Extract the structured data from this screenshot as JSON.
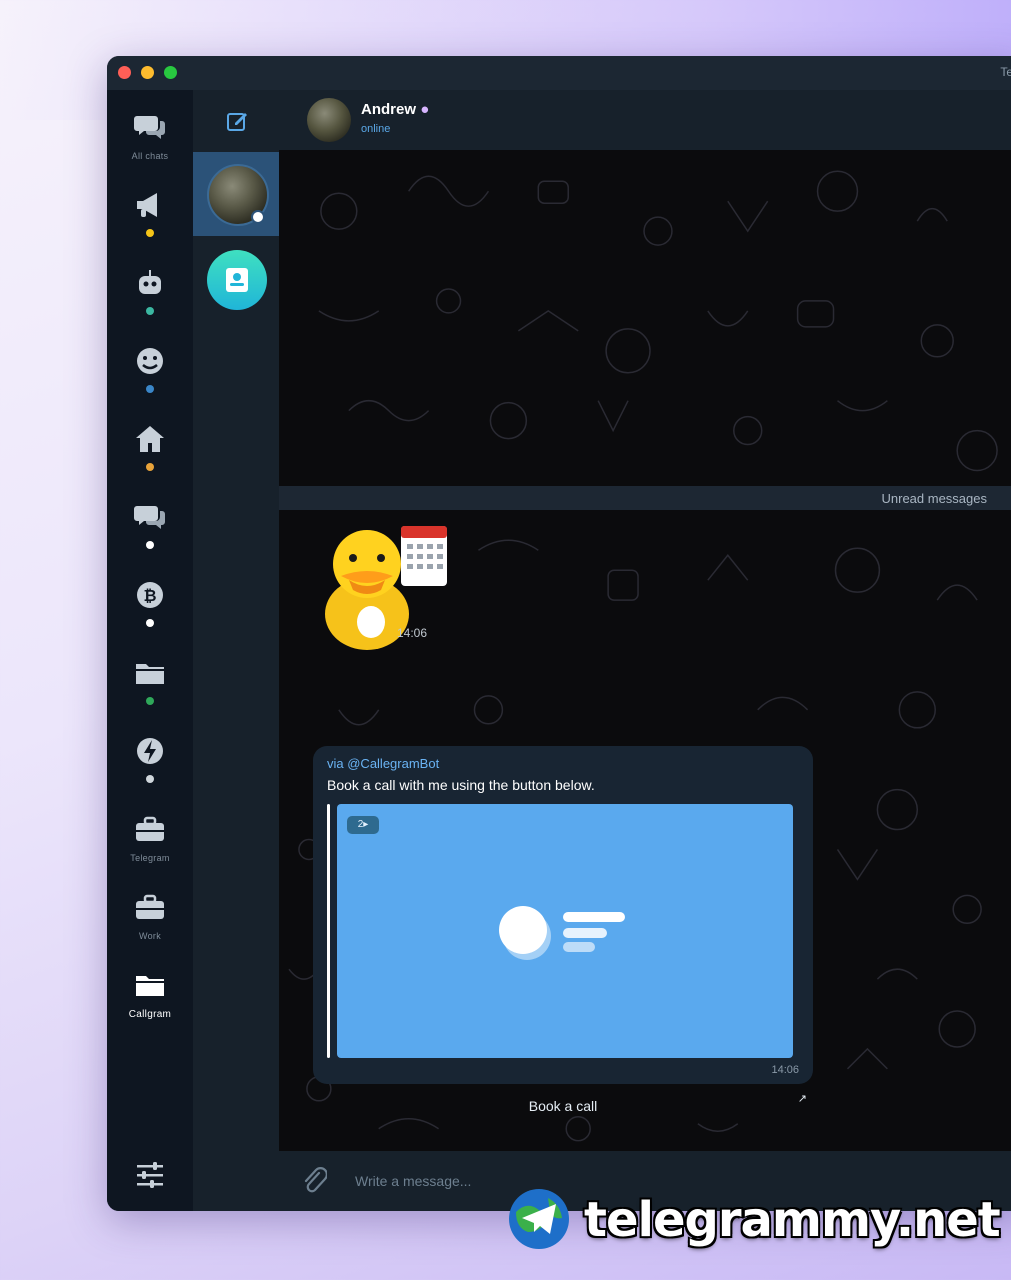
{
  "window": {
    "title": "Te"
  },
  "folders": [
    {
      "id": "all-chats",
      "label": "All chats",
      "icon": "chats-icon",
      "dot": ""
    },
    {
      "id": "channels",
      "label": "",
      "icon": "megaphone-icon",
      "dot": "#f5c518"
    },
    {
      "id": "bots",
      "label": "",
      "icon": "robot-icon",
      "dot": "#3bb7a1"
    },
    {
      "id": "groups",
      "label": "",
      "icon": "emoji-icon",
      "dot": "#3a86c8"
    },
    {
      "id": "home",
      "label": "",
      "icon": "house-icon",
      "dot": "#e8a33a"
    },
    {
      "id": "chats",
      "label": "",
      "icon": "chats-icon",
      "dot": "#ffffff"
    },
    {
      "id": "crypto",
      "label": "",
      "icon": "bitcoin-icon",
      "dot": "#ffffff"
    },
    {
      "id": "folder",
      "label": "",
      "icon": "folder-icon",
      "dot": "#2fa85a"
    },
    {
      "id": "fast",
      "label": "",
      "icon": "lightning-icon",
      "dot": "#cfd6dc"
    },
    {
      "id": "work-1",
      "label": "Telegram",
      "icon": "briefcase-icon",
      "dot": ""
    },
    {
      "id": "work-2",
      "label": "Work",
      "icon": "briefcase-icon",
      "dot": ""
    },
    {
      "id": "callgram",
      "label": "Callgram",
      "icon": "folder-icon",
      "dot": ""
    }
  ],
  "header": {
    "name": "Andrew",
    "status": "online"
  },
  "chat": {
    "unread_label": "Unread messages",
    "sticker_time": "14:06",
    "bubble": {
      "via": "via @CallegramBot",
      "text": "Book a call with me using the button below.",
      "badge": "2▸",
      "time": "14:06"
    },
    "button_label": "Book a call",
    "button_arrow": "↗"
  },
  "composer": {
    "placeholder": "Write a message..."
  },
  "watermark": {
    "text": "telegrammy.net"
  },
  "colors": {
    "accent": "#2b5278",
    "preview": "#5aa9ee",
    "link": "#6ab3f3"
  }
}
